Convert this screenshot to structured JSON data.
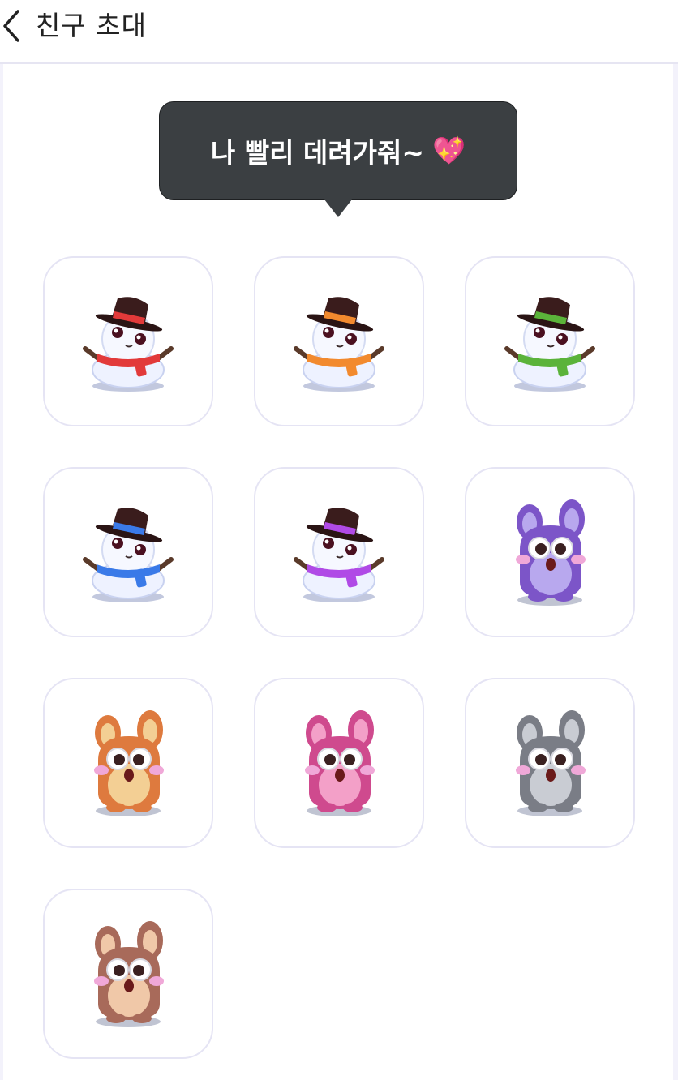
{
  "header": {
    "title": "친구 초대"
  },
  "tooltip": {
    "message": "나 빨리 데려가줘~",
    "emoji": "💖"
  },
  "characters": [
    {
      "kind": "snowman",
      "color": "#e23a3a"
    },
    {
      "kind": "snowman",
      "color": "#f28a2e"
    },
    {
      "kind": "snowman",
      "color": "#5bb33a"
    },
    {
      "kind": "snowman",
      "color": "#3a7ae8"
    },
    {
      "kind": "snowman",
      "color": "#b04ae6"
    },
    {
      "kind": "critter",
      "color": "#7c55c8",
      "belly": "#b8a8ee"
    },
    {
      "kind": "critter",
      "color": "#de7a3e",
      "belly": "#f3cf94"
    },
    {
      "kind": "critter",
      "color": "#cf4a8e",
      "belly": "#f3a0c8"
    },
    {
      "kind": "critter",
      "color": "#7a7d86",
      "belly": "#c9ccd3"
    },
    {
      "kind": "critter",
      "color": "#a86a5a",
      "belly": "#f0c8a8"
    }
  ]
}
